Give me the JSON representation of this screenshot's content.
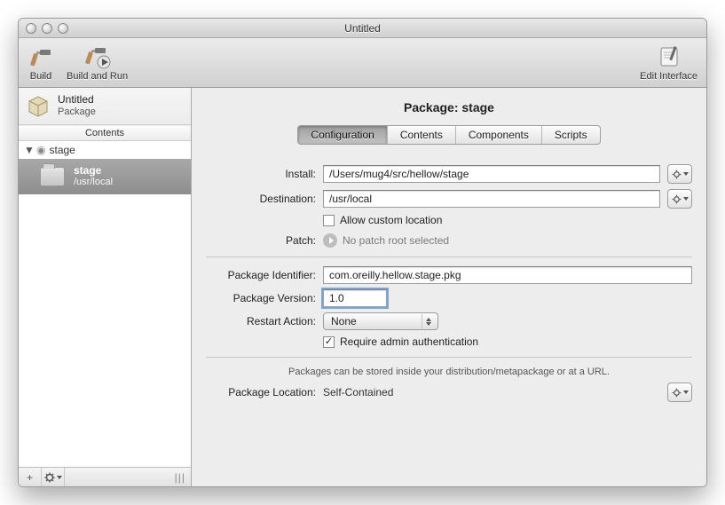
{
  "window": {
    "title": "Untitled"
  },
  "toolbar": {
    "build": "Build",
    "build_run": "Build and Run",
    "edit_interface": "Edit Interface"
  },
  "sidebar": {
    "project_title": "Untitled",
    "project_subtitle": "Package",
    "contents_label": "Contents",
    "root_item": "stage",
    "selected": {
      "title": "stage",
      "path": "/usr/local"
    },
    "add_label": "+"
  },
  "panel": {
    "title": "Package: stage",
    "tabs": [
      "Configuration",
      "Contents",
      "Components",
      "Scripts"
    ],
    "install_label": "Install:",
    "install_value": "/Users/mug4/src/hellow/stage",
    "destination_label": "Destination:",
    "destination_value": "/usr/local",
    "allow_custom_label": "Allow custom location",
    "patch_label": "Patch:",
    "patch_value": "No patch root selected",
    "identifier_label": "Package Identifier:",
    "identifier_value": "com.oreilly.hellow.stage.pkg",
    "version_label": "Package Version:",
    "version_value": "1.0",
    "restart_label": "Restart Action:",
    "restart_value": "None",
    "require_admin_label": "Require admin authentication",
    "hint": "Packages can be stored inside your distribution/metapackage or at a URL.",
    "location_label": "Package Location:",
    "location_value": "Self-Contained"
  }
}
